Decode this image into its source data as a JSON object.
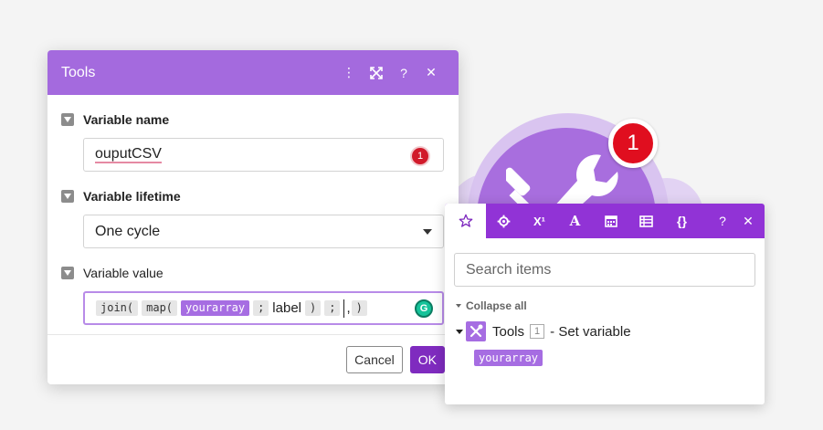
{
  "module": {
    "badge": "1",
    "colors": {
      "core": "#a86ede",
      "halo": "#d9c4f0",
      "badge": "#e00e1f"
    }
  },
  "dialog": {
    "title": "Tools",
    "header_icons": [
      "more-vert-icon",
      "expand-icon",
      "help-icon",
      "close-icon"
    ],
    "help_label": "?",
    "close_label": "✕",
    "more_label": "⋮",
    "fields": {
      "variable_name": {
        "label": "Variable name",
        "value": "ouputCSV",
        "error_count": "1"
      },
      "variable_lifetime": {
        "label": "Variable lifetime",
        "value": "One cycle"
      },
      "variable_value": {
        "label": "Variable value",
        "tokens": {
          "join": "join(",
          "map": "map(",
          "array": "yourarray",
          "sep1": ";",
          "label": "label",
          "close1": ")",
          "sep2": ";",
          "comma": ",",
          "close2": ")"
        }
      }
    },
    "footer": {
      "cancel_label": "Cancel",
      "ok_label": "OK"
    },
    "colors": {
      "header": "#a46ade",
      "ok_button": "#7f2bbf"
    }
  },
  "panel": {
    "tabs": [
      "star-icon",
      "gear-icon",
      "superscript-icon",
      "text-icon",
      "calendar-icon",
      "table-icon",
      "braces-icon"
    ],
    "tab_labels": {
      "super": "X¹",
      "text": "A",
      "braces": "{}"
    },
    "help_label": "?",
    "close_label": "✕",
    "search_placeholder": "Search items",
    "collapse_label": "Collapse all",
    "tree": {
      "module_name": "Tools",
      "module_number": "1",
      "module_action": "- Set variable",
      "items": [
        "yourarray"
      ]
    },
    "colors": {
      "tab_bar": "#9133d6",
      "variable_pill": "#a66de2"
    }
  }
}
